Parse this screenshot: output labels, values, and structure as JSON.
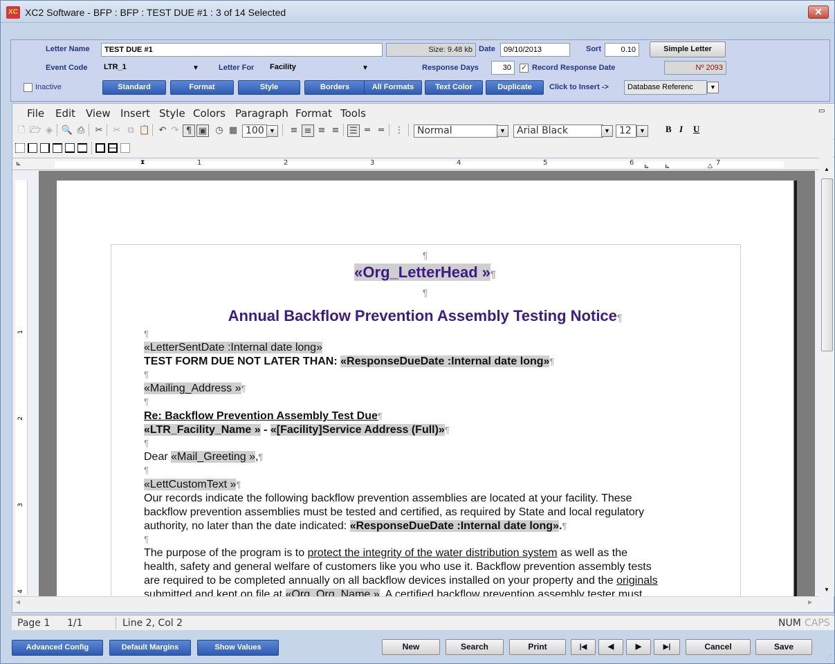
{
  "window": {
    "title": "XC2 Software - BFP : BFP : TEST DUE #1 : 3 of 14 Selected",
    "icon": "XC2 logo",
    "close": "✕"
  },
  "header": {
    "letter_name_label": "Letter Name",
    "letter_name": "TEST DUE #1",
    "size": "Size: 9.48 kb",
    "date_label": "Date",
    "date": "09/10/2013",
    "sort_label": "Sort",
    "sort": "0.10",
    "simple_letter": "Simple Letter",
    "event_code_label": "Event Code",
    "event_code": "LTR_1",
    "letter_for_label": "Letter For",
    "letter_for": "Facility",
    "response_days_label": "Response Days",
    "response_days": "30",
    "record_response_label": "Record Response Date",
    "record_response_checked": true,
    "number": "Nº 2093",
    "inactive_label": "Inactive",
    "inactive_checked": false,
    "buttons": [
      "Standard",
      "Format",
      "Style",
      "Borders",
      "All Formats",
      "Text Color",
      "Duplicate"
    ],
    "click_to_insert": "Click to Insert ->",
    "insert_value": "Database Referenc"
  },
  "menu": [
    "File",
    "Edit",
    "View",
    "Insert",
    "Style",
    "Colors",
    "Paragraph",
    "Format",
    "Tools"
  ],
  "toolbar": {
    "zoom": "100",
    "style": "Normal",
    "font": "Arial Black",
    "size": "12",
    "bold": "B",
    "italic": "I",
    "underline": "U"
  },
  "ruler": {
    "numbers": [
      "1",
      "2",
      "3",
      "4",
      "5",
      "6",
      "7"
    ],
    "vnumbers": [
      "1",
      "2",
      "3",
      "4"
    ]
  },
  "document": {
    "pilcrow": "¶",
    "letterhead": "«Org_LetterHead »",
    "title": "Annual Backflow Prevention Assembly Testing Notice",
    "sent_date": "«LetterSentDate :Internal date long»",
    "due_prefix": "TEST FORM DUE NOT LATER THAN: ",
    "due_field": "«ResponseDueDate :Internal date long»",
    "mailing": "«Mailing_Address »",
    "re": "Re: Backflow Prevention Assembly Test Due",
    "facility_name": "«LTR_Facility_Name »",
    "facility_sep": " - ",
    "facility_address": "«[Facility]Service Address (Full)»",
    "dear": "Dear ",
    "greeting": "«Mail_Greeting »",
    "greeting_comma": ",",
    "custom_text": "«LettCustomText »",
    "p1_l1": "Our records indicate the following backflow prevention assemblies are located at your facility.  These",
    "p1_l2": "backflow prevention assemblies must be tested and certified, as required by State and local regulatory",
    "p1_l3": "authority, no later than the date indicated:  ",
    "p1_field": "«ResponseDueDate :Internal date long»",
    "p1_end": ".",
    "p2_l1a": "The purpose of the program is to ",
    "p2_l1u": "protect the integrity of the water distribution system",
    "p2_l1b": " as well as the",
    "p2_l2": "health, safety and general welfare of customers like you who use it.  Backflow prevention assembly tests",
    "p2_l3a": "are required to be completed annually on all backflow devices installed on your property and the ",
    "p2_l3u": "originals",
    "p2_l4a": "submitted and kept on file at ",
    "p2_l4f": "«Org_Org_Name »",
    "p2_l4b": ".  A certified backflow prevention assembly tester must"
  },
  "status": {
    "page": "Page 1",
    "pages": "1/1",
    "line": "Line 2, Col 2",
    "num": "NUM",
    "caps": "CAPS"
  },
  "bottom": {
    "advanced": "Advanced Config",
    "margins": "Default Margins",
    "show_values": "Show Values",
    "new": "New",
    "search": "Search",
    "print": "Print",
    "first": "|◀",
    "prev": "◀",
    "next": "▶",
    "last": "▶|",
    "cancel": "Cancel",
    "save": "Save"
  }
}
